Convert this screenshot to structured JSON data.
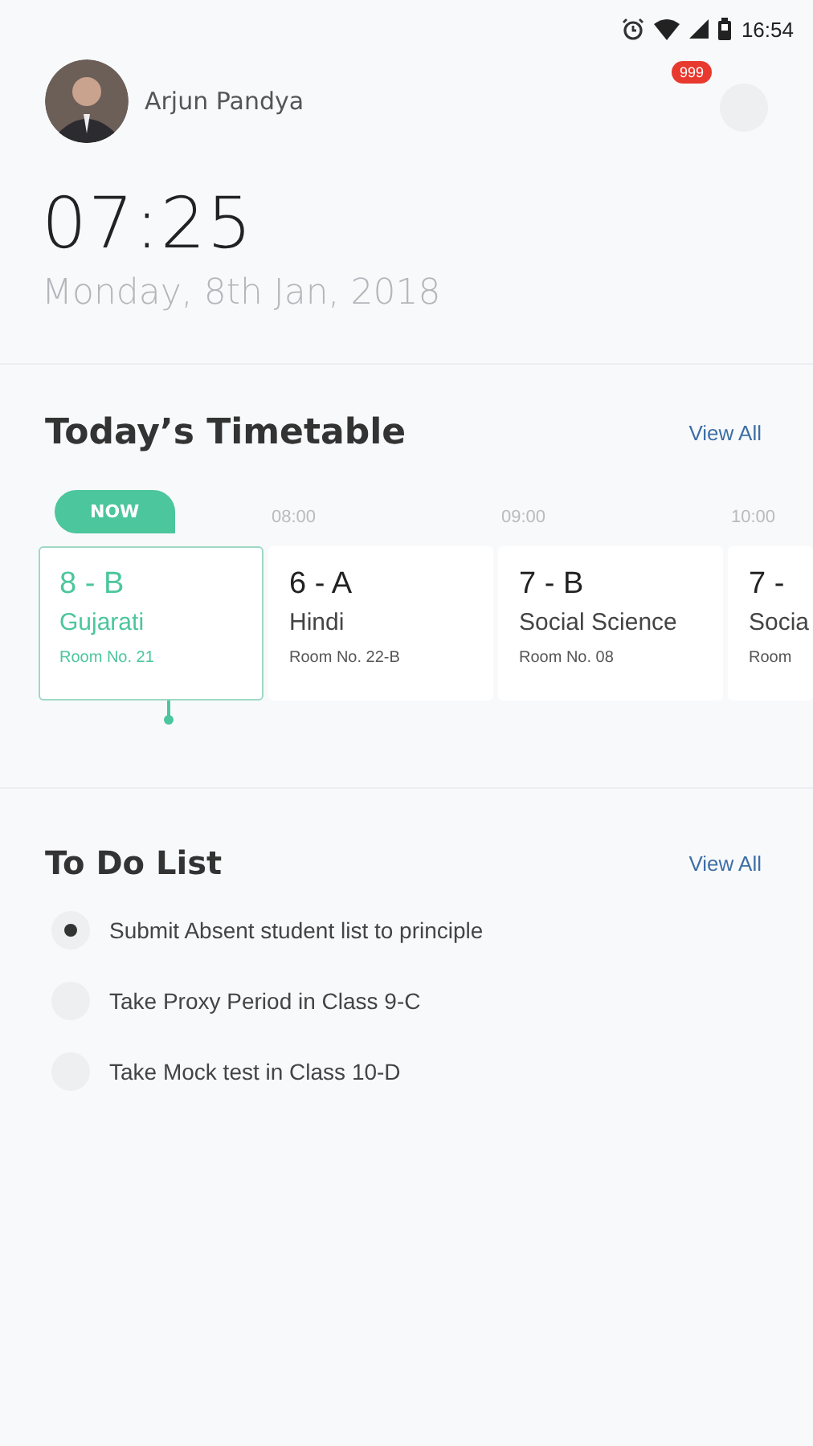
{
  "status_bar": {
    "time": "16:54"
  },
  "profile": {
    "name": "Arjun Pandya",
    "notification_count": "999"
  },
  "clock": {
    "time": "07:25",
    "date": "Monday, 8th Jan, 2018"
  },
  "timetable": {
    "title": "Today’s Timetable",
    "view_all": "View All",
    "slots": [
      {
        "current": true,
        "marker": "NOW",
        "class": "8 - B",
        "subject": "Gujarati",
        "room": "Room No. 21"
      },
      {
        "current": false,
        "marker": "08:00",
        "class": "6 - A",
        "subject": "Hindi",
        "room": "Room No. 22-B"
      },
      {
        "current": false,
        "marker": "09:00",
        "class": "7 - B",
        "subject": "Social Science",
        "room": "Room No. 08"
      },
      {
        "current": false,
        "marker": "10:00",
        "class": "7 -",
        "subject": "Socia",
        "room": "Room"
      }
    ]
  },
  "todo": {
    "title": "To Do List",
    "view_all": "View All",
    "items": [
      {
        "text": "Submit Absent student list to principle",
        "checked": true
      },
      {
        "text": "Take Proxy Period in Class 9-C",
        "checked": false
      },
      {
        "text": "Take Mock test in Class 10-D",
        "checked": false
      }
    ]
  }
}
